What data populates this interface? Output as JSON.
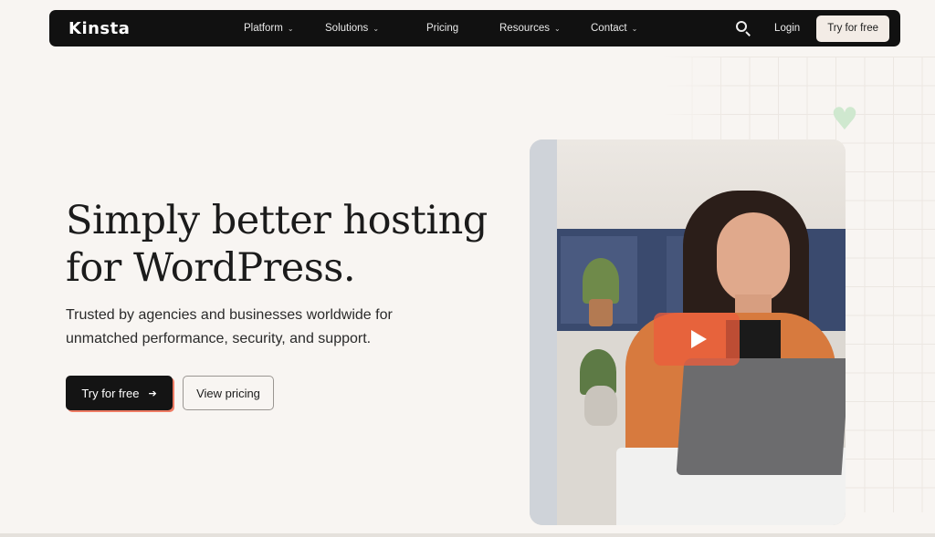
{
  "nav": {
    "logo": "Kinsta",
    "items": [
      {
        "label": "Platform",
        "has_dropdown": true
      },
      {
        "label": "Solutions",
        "has_dropdown": true
      },
      {
        "label": "Pricing",
        "has_dropdown": false
      },
      {
        "label": "Resources",
        "has_dropdown": true
      },
      {
        "label": "Contact",
        "has_dropdown": true
      }
    ],
    "search_icon": "search-icon",
    "login": "Login",
    "cta": "Try for free"
  },
  "hero": {
    "title": "Simply better hosting for WordPress.",
    "subtitle": "Trusted by agencies and businesses worldwide for unmatched performance, security, and support.",
    "primary_cta": "Try for free",
    "primary_cta_icon": "arrow-right-icon",
    "secondary_cta": "View pricing",
    "media_icon": "play-icon"
  },
  "colors": {
    "background": "#f8f5f2",
    "nav_background": "#111111",
    "accent": "#ee7b64",
    "play_button": "#ec5c3c"
  }
}
